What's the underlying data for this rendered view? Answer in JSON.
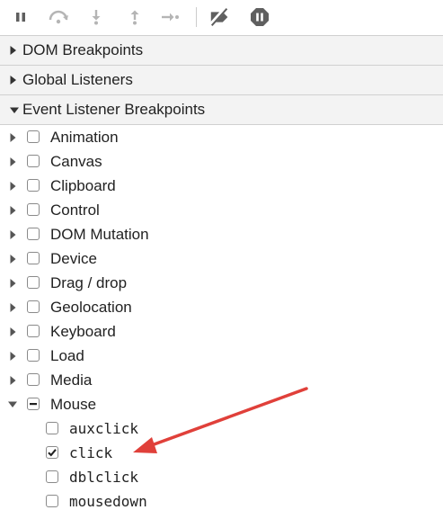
{
  "toolbar": {
    "buttons": [
      {
        "name": "pause-icon",
        "title": "Pause script execution"
      },
      {
        "name": "step-over-icon",
        "title": "Step over next function call"
      },
      {
        "name": "step-into-icon",
        "title": "Step into next function call"
      },
      {
        "name": "step-out-icon",
        "title": "Step out of current function"
      },
      {
        "name": "step-icon",
        "title": "Step"
      },
      {
        "name": "deactivate-breakpoints-icon",
        "title": "Deactivate breakpoints"
      },
      {
        "name": "pause-on-exceptions-icon",
        "title": "Pause on exceptions"
      }
    ]
  },
  "sections": {
    "dom_breakpoints": {
      "label": "DOM Breakpoints",
      "expanded": false
    },
    "global_listeners": {
      "label": "Global Listeners",
      "expanded": false
    },
    "event_listener_breakpoints": {
      "label": "Event Listener Breakpoints",
      "expanded": true
    }
  },
  "categories": [
    {
      "label": "Animation",
      "expanded": false,
      "state": "unchecked"
    },
    {
      "label": "Canvas",
      "expanded": false,
      "state": "unchecked"
    },
    {
      "label": "Clipboard",
      "expanded": false,
      "state": "unchecked"
    },
    {
      "label": "Control",
      "expanded": false,
      "state": "unchecked"
    },
    {
      "label": "DOM Mutation",
      "expanded": false,
      "state": "unchecked"
    },
    {
      "label": "Device",
      "expanded": false,
      "state": "unchecked"
    },
    {
      "label": "Drag / drop",
      "expanded": false,
      "state": "unchecked"
    },
    {
      "label": "Geolocation",
      "expanded": false,
      "state": "unchecked"
    },
    {
      "label": "Keyboard",
      "expanded": false,
      "state": "unchecked"
    },
    {
      "label": "Load",
      "expanded": false,
      "state": "unchecked"
    },
    {
      "label": "Media",
      "expanded": false,
      "state": "unchecked"
    },
    {
      "label": "Mouse",
      "expanded": true,
      "state": "indeterminate"
    }
  ],
  "mouse_events": [
    {
      "label": "auxclick",
      "checked": false
    },
    {
      "label": "click",
      "checked": true
    },
    {
      "label": "dblclick",
      "checked": false
    },
    {
      "label": "mousedown",
      "checked": false
    }
  ],
  "colors": {
    "annotation_arrow": "#e0403a",
    "toolbar_icon": "#6e6e6e",
    "toolbar_icon_disabled": "#b5b5b5",
    "section_background": "#f3f3f3"
  }
}
